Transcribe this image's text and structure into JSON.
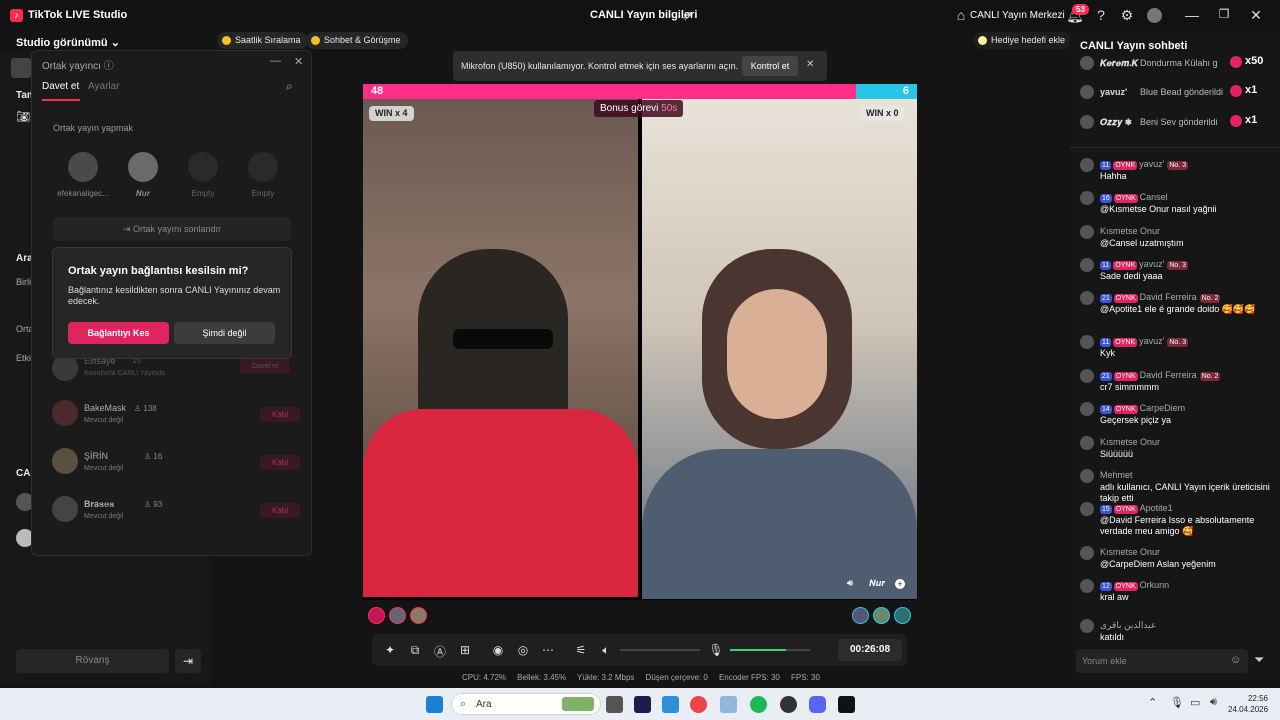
{
  "app": {
    "title": "TikTok LIVE Studio",
    "center_title": "CANLI Yayın bilgileri",
    "live_center": "CANLI Yayın Merkezi",
    "notif_count": "53"
  },
  "toolbar": {
    "studio_view": "Studio görünümü",
    "chip1": "Saatlik Sıralama",
    "chip2": "Sohbet & Görüşme",
    "chip3": "Hediye hedefi ekle"
  },
  "left": {
    "tam": "Tam",
    "ara": "Ara",
    "birli": "Birli",
    "orta": "Orta",
    "etki": "Etki",
    "can": "CAN",
    "rematch": "Rövanş"
  },
  "coop": {
    "title": "Ortak yayıncı",
    "tab_invite": "Davet et",
    "tab_settings": "Ayarlar",
    "section": "Ortak yayın yapmak",
    "slots": [
      "efekanaligec...",
      "𝑵𝒖𝒓",
      "Empty",
      "Empty"
    ],
    "end_button": "Ortak yayını sonlandır",
    "list": [
      {
        "name": "Elifsaye",
        "count": "15",
        "status": "Kooutlarla CANLI Yayında",
        "action": "Davet et"
      },
      {
        "name": "BakeMask",
        "count": "138",
        "status": "Mevcut değil",
        "action": "Katıl"
      },
      {
        "name": "ŞİRİN",
        "count": "16",
        "status": "Mevcut değil",
        "action": "Katıl"
      },
      {
        "name": "𝐁𝐫𝐚𝐬𝐞𝐬",
        "count": "93",
        "status": "Mevcut değil",
        "action": "Katıl"
      }
    ]
  },
  "dialog": {
    "title": "Ortak yayın bağlantısı kesilsin mi?",
    "body": "Bağlantınız kesildikten sonra CANLI Yayınınız devam edecek.",
    "confirm": "Bağlantıyı Kes",
    "cancel": "Şimdi değil"
  },
  "toast": {
    "text": "Mikrofon (U850) kullanılamıyor. Kontrol etmek için ses ayarlarını açın.",
    "action": "Kontrol et"
  },
  "battle": {
    "left_score": "48",
    "right_score": "6",
    "left_win": "WIN x 4",
    "right_win": "WIN x 0",
    "bonus": "Bonus görevi",
    "bonus_time": "50s",
    "left_share": 0.89,
    "right_name": "𝑵𝒖𝒓"
  },
  "controls": {
    "timer": "00:26:08",
    "volume": 0.7
  },
  "stats": {
    "cpu": "CPU: 4.72%",
    "mem": "Bellek: 3.45%",
    "upload": "Yükle: 3.2 Mbps",
    "dropped": "Düşen çerçeve: 0",
    "encoder": "Encoder FPS: 30",
    "fps": "FPS: 30"
  },
  "chat": {
    "title": "CANLI Yayın sohbeti",
    "gifts": [
      {
        "user": "𝑲𝒆𝒓𝒆𝒎.𝑲",
        "text": "Dondurma Külahı g",
        "mult": "x50"
      },
      {
        "user": "yavuz'",
        "text": "Blue Bead gönderildi",
        "mult": "x1"
      },
      {
        "user": "𝑶𝒛𝒛𝒚 ✱",
        "text": "Beni Sev gönderildi",
        "mult": "x1"
      }
    ],
    "messages": [
      {
        "lvl": "11",
        "fan": "OYNK",
        "user": "yavuz'",
        "no": "No. 3",
        "text": "Hahha"
      },
      {
        "lvl": "16",
        "fan": "OYNK",
        "user": "Cansel",
        "no": "",
        "text": "@Kısmetse Onur nasıl yağnii"
      },
      {
        "lvl": "",
        "fan": "",
        "user": "Kısmetse Onur",
        "no": "",
        "text": "@Cansel uzatmıştım"
      },
      {
        "lvl": "11",
        "fan": "OYNK",
        "user": "yavuz'",
        "no": "No. 3",
        "text": "Sade dedi yaaa"
      },
      {
        "lvl": "21",
        "fan": "OYNK",
        "user": "David Ferreira",
        "no": "No. 2",
        "text": "@Apotite1 ele é grande doido 🥰🥰🥰"
      },
      {
        "lvl": "11",
        "fan": "OYNK",
        "user": "yavuz'",
        "no": "No. 3",
        "text": "Kyk"
      },
      {
        "lvl": "21",
        "fan": "OYNK",
        "user": "David Ferreira",
        "no": "No. 2",
        "text": "cr7 simmmmm"
      },
      {
        "lvl": "14",
        "fan": "OYNK",
        "user": "CarpeDiem",
        "no": "",
        "text": "Geçersek piçiz ya"
      },
      {
        "lvl": "",
        "fan": "",
        "user": "Kısmetse Onur",
        "no": "",
        "text": "Siüüüüü"
      },
      {
        "lvl": "",
        "fan": "",
        "user": "Mehmet",
        "no": "",
        "text": "adlı kullanıcı, CANLI Yayın içerik üreticisini takip etti"
      },
      {
        "lvl": "15",
        "fan": "OYNK",
        "user": "Apotite1",
        "no": "",
        "text": "@David Ferreira Isso e absolutamente verdade meu amigo 🥰"
      },
      {
        "lvl": "",
        "fan": "",
        "user": "Kısmetse Onur",
        "no": "",
        "text": "@CarpeDiem Aslan yeğenim"
      },
      {
        "lvl": "12",
        "fan": "OYNK",
        "user": "Orkunn",
        "no": "",
        "text": "kral aw"
      },
      {
        "lvl": "",
        "fan": "",
        "user": "عبدالدين باقری",
        "no": "",
        "text": "katıldı"
      }
    ],
    "input_placeholder": "Yorum ekle"
  },
  "taskbar": {
    "search": "Ara",
    "time": "22:56",
    "date": "24.04.2026"
  },
  "colors": {
    "accent": "#fe2c55",
    "score_left": "#ff2d87",
    "score_right": "#27c6e8",
    "volume": "#36d67a"
  }
}
